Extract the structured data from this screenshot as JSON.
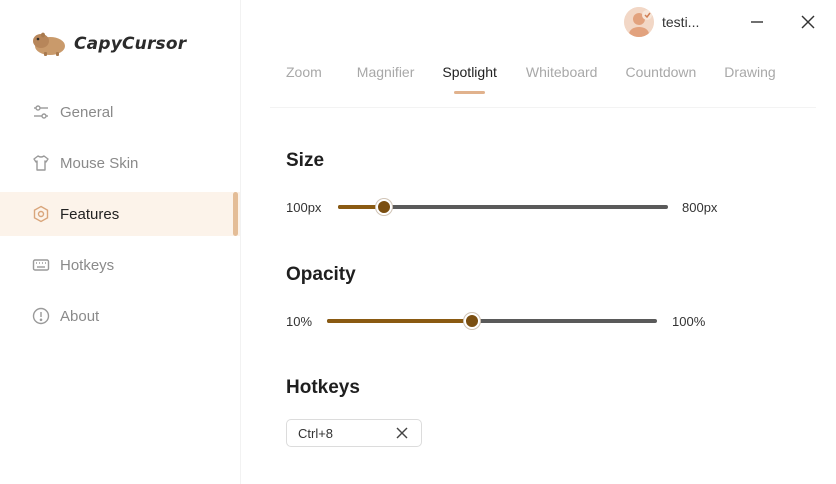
{
  "app": {
    "name": "CapyCursor",
    "accent_color": "#e4bd97",
    "active_bg_color": "#fcf3ea",
    "slider_fill_color": "#8a5a12"
  },
  "sidebar": {
    "items": [
      {
        "label": "General",
        "icon": "sliders-icon",
        "active": false
      },
      {
        "label": "Mouse Skin",
        "icon": "tshirt-icon",
        "active": false
      },
      {
        "label": "Features",
        "icon": "hexagon-icon",
        "active": true
      },
      {
        "label": "Hotkeys",
        "icon": "keyboard-icon",
        "active": false
      },
      {
        "label": "About",
        "icon": "info-icon",
        "active": false
      }
    ]
  },
  "header": {
    "username": "testi...",
    "minimize_icon": "minimize-icon",
    "close_icon": "close-icon"
  },
  "tabs": [
    {
      "label": "Zoom",
      "active": false
    },
    {
      "label": "Magnifier",
      "active": false
    },
    {
      "label": "Spotlight",
      "active": true
    },
    {
      "label": "Whiteboard",
      "active": false
    },
    {
      "label": "Countdown",
      "active": false
    },
    {
      "label": "Drawing",
      "active": false
    }
  ],
  "spotlight": {
    "size": {
      "title": "Size",
      "min_label": "100px",
      "max_label": "800px",
      "value_fraction": 0.14
    },
    "opacity": {
      "title": "Opacity",
      "min_label": "10%",
      "max_label": "100%",
      "value_fraction": 0.44
    },
    "hotkeys": {
      "title": "Hotkeys",
      "value": "Ctrl+8",
      "clear_icon": "clear-x-icon"
    }
  }
}
